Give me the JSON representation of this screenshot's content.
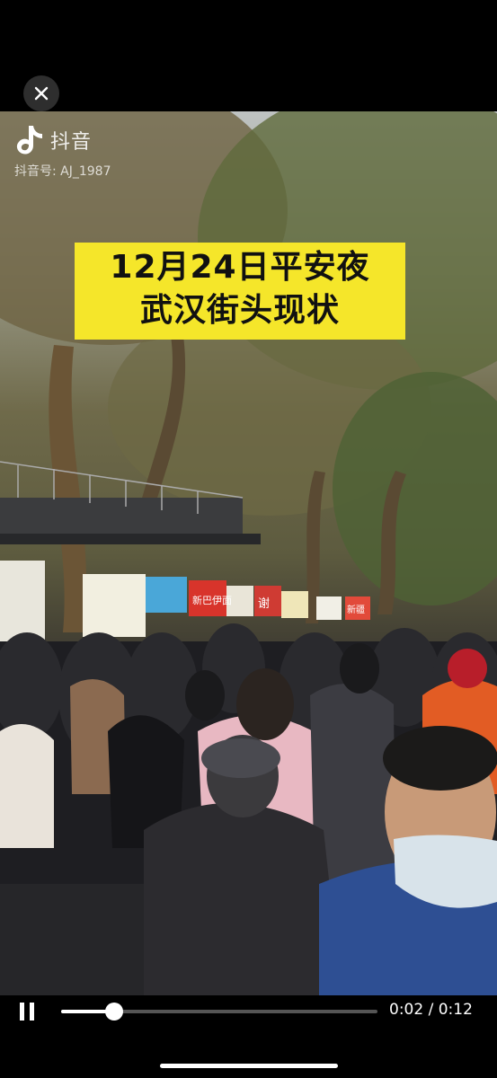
{
  "video": {
    "watermark": {
      "app_name": "抖音",
      "account_id": "抖音号: AJ_1987"
    },
    "caption": {
      "line1": "12月24日平安夜",
      "line2": "武汉街头现状"
    },
    "storefront_signs": [
      "新巴伊面",
      "谢",
      "新疆"
    ]
  },
  "player": {
    "current_time": "0:02",
    "separator": "/",
    "duration": "0:12",
    "progress_fraction": 0.167
  },
  "icons": {
    "close": "close-icon",
    "douyin_logo": "douyin-logo-icon",
    "pause": "pause-icon"
  },
  "colors": {
    "caption_bg": "#f5e62a",
    "background": "#000000"
  }
}
